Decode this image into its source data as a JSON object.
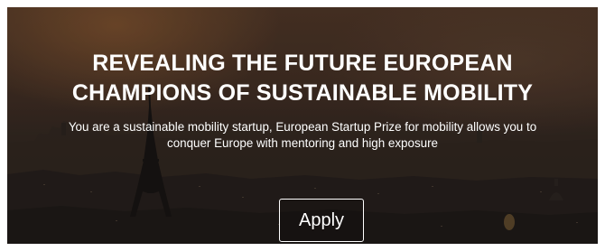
{
  "hero": {
    "title_lines": [
      "REVEALING THE FUTURE EUROPEAN",
      "CHAMPIONS OF SUSTAINABLE MOBILITY"
    ],
    "subtitle_lines": [
      "You are a sustainable mobility startup, European Startup Prize for mobility allows you to",
      "conquer Europe with mentoring and high exposure"
    ],
    "apply_label": "Apply",
    "background_image": "paris-skyline-sunset-icon"
  },
  "colors": {
    "text": "#ffffff",
    "sky_warm": "#4b3425",
    "city_dark": "#27211e"
  }
}
